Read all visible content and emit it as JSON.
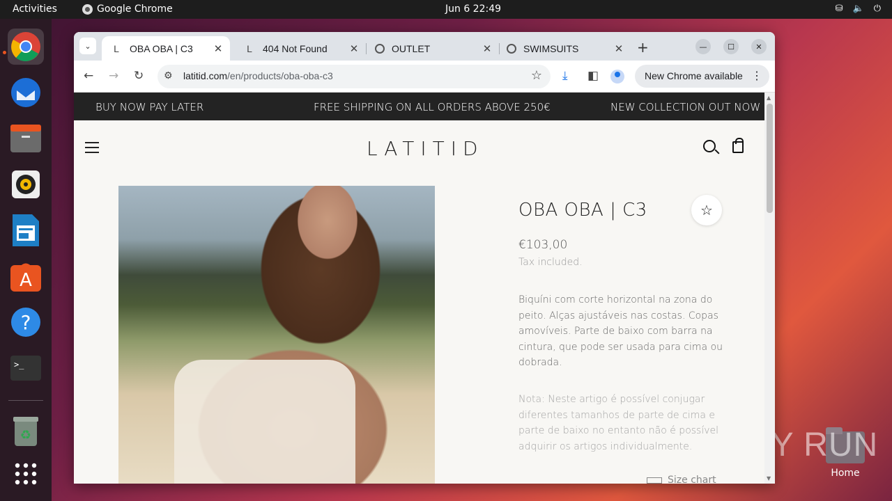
{
  "topbar": {
    "activities": "Activities",
    "app_name": "Google Chrome",
    "clock": "Jun 6  22:49",
    "icons": [
      "network-icon",
      "volume-icon",
      "power-icon"
    ]
  },
  "dock": {
    "items": [
      "chrome-icon",
      "thunderbird-icon",
      "files-icon",
      "rhythmbox-icon",
      "writer-icon",
      "app-center-icon",
      "help-icon",
      "terminal-icon",
      "trash-icon",
      "app-grid-icon"
    ]
  },
  "desktop": {
    "home_label": "Home",
    "watermark": "ANY RUN"
  },
  "browser": {
    "tabs": [
      {
        "label": "OBA OBA | C3",
        "favicon": "L",
        "active": true
      },
      {
        "label": "404 Not Found",
        "favicon": "L",
        "active": false
      },
      {
        "label": "OUTLET",
        "favicon": "globe",
        "active": false
      },
      {
        "label": "SWIMSUITS",
        "favicon": "globe",
        "active": false
      }
    ],
    "new_tab": "+",
    "url_host": "latitid.com",
    "url_path": "/en/products/oba-oba-c3",
    "update_label": "New Chrome available"
  },
  "site": {
    "announcements": [
      "BUY NOW PAY LATER",
      "FREE SHIPPING ON ALL ORDERS ABOVE 250€",
      "NEW COLLECTION OUT NOW"
    ],
    "logo": "LATITID",
    "product": {
      "title": "OBA OBA | C3",
      "price": "€103,00",
      "tax_note": "Tax included.",
      "description": "Biquíni com corte horizontal na zona do peito. Alças ajustáveis nas costas. Copas amovíveis. Parte de baixo com barra na cintura, que pode ser usada para cima ou dobrada.",
      "note": "Nota: Neste artigo é possível conjugar diferentes tamanhos de parte de cima e parte de baixo no entanto não é possível adquirir os artigos individualmente.",
      "size_chart": "Size chart"
    }
  },
  "colors": {
    "announce_bg": "#232323",
    "page_bg": "#f8f7f4",
    "accent": "#e95420"
  }
}
